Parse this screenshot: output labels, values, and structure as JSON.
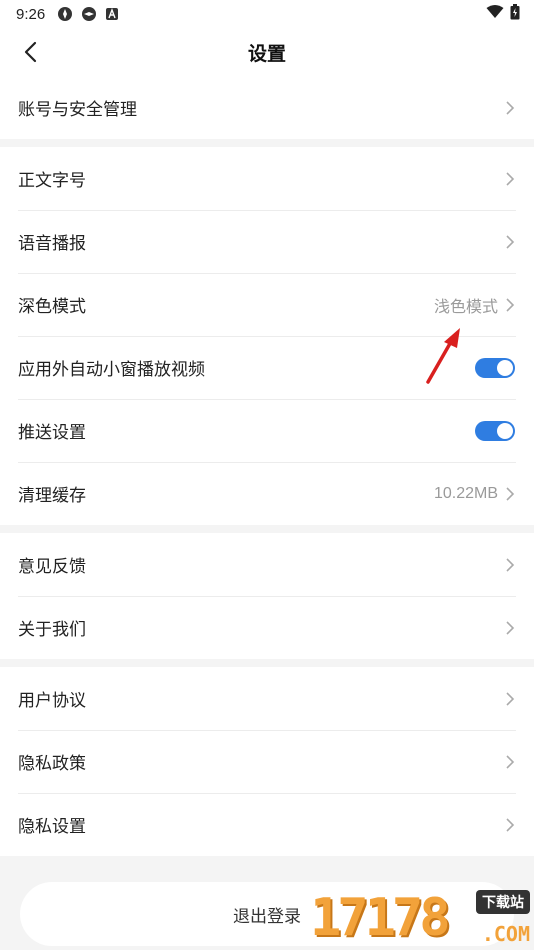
{
  "status_bar": {
    "time": "9:26",
    "icons": [
      "game-icon",
      "game-icon",
      "a-icon"
    ],
    "right_icons": [
      "wifi-icon",
      "battery-icon"
    ]
  },
  "nav": {
    "title": "设置",
    "back_icon": "chevron-left-icon"
  },
  "groups": [
    {
      "items": [
        {
          "label": "账号与安全管理",
          "type": "link"
        }
      ]
    },
    {
      "items": [
        {
          "label": "正文字号",
          "type": "link"
        },
        {
          "label": "语音播报",
          "type": "link"
        },
        {
          "label": "深色模式",
          "type": "link",
          "value": "浅色模式"
        },
        {
          "label": "应用外自动小窗播放视频",
          "type": "toggle",
          "on": true
        },
        {
          "label": "推送设置",
          "type": "toggle",
          "on": true
        },
        {
          "label": "清理缓存",
          "type": "link",
          "value": "10.22MB"
        }
      ]
    },
    {
      "items": [
        {
          "label": "意见反馈",
          "type": "link"
        },
        {
          "label": "关于我们",
          "type": "link"
        }
      ]
    },
    {
      "items": [
        {
          "label": "用户协议",
          "type": "link"
        },
        {
          "label": "隐私政策",
          "type": "link"
        },
        {
          "label": "隐私设置",
          "type": "link"
        }
      ]
    }
  ],
  "logout_label": "退出登录",
  "watermark": {
    "number": "17178",
    "tag": "下载站",
    "suffix": ".COM"
  },
  "colors": {
    "toggle_on": "#2f7de1",
    "annotation_arrow": "#d9201f"
  }
}
